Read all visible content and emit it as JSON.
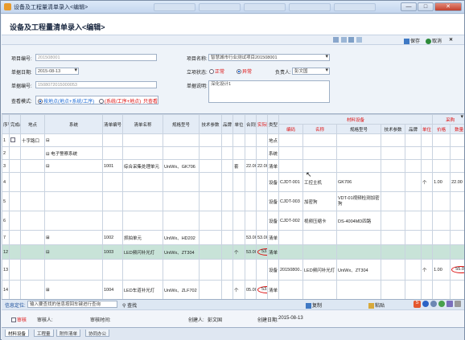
{
  "window": {
    "title": "设备及工程量清单录入<编辑>",
    "tabs": [
      "",
      "",
      "",
      "",
      ""
    ],
    "min": "—",
    "max": "□",
    "close": "✕"
  },
  "header": {
    "title": "设备及工程量清单录入<编辑>"
  },
  "toolbar": {
    "save": "保存",
    "cancel": "取消"
  },
  "form": {
    "project_no_label": "项目编号:",
    "project_no": "201508001",
    "project_name_label": "项目名称:",
    "project_name": "智慧城市行业测试项目201508001",
    "date_label": "单据日期:",
    "date": "2015-08-13",
    "status_label": "立项状态:",
    "status_normal": "正常",
    "status_abnormal": "异常",
    "owner_label": "负责人:",
    "owner": "彭文国",
    "doc_no_label": "单据编号:",
    "doc_no": "1508072015000053",
    "desc_label": "单据说明:",
    "desc": "深化设计1",
    "view_label": "查看模式:",
    "view_opt1": "按地点(地点+系统/工序)",
    "view_opt2": "(系统/工序+地点)",
    "view_opt3": "只查看"
  },
  "table": {
    "headers": {
      "seq": "序号",
      "complete": "完成/深化",
      "location": "地点",
      "system": "系统",
      "list_no": "清单编号",
      "list_name": "清单名称",
      "spec": "规格型号",
      "tech": "技术参数",
      "brand": "品牌",
      "unit": "单位",
      "contract_qty": "合同数量",
      "actual_qty": "实际数量",
      "type": "类型",
      "material_group": "材料设备",
      "m_code": "编码",
      "m_name": "名称",
      "m_spec": "规格型号",
      "m_tech": "技术参数",
      "m_brand": "品牌",
      "m_unit": "单位",
      "purchase_group": "采购",
      "p_price": "价格",
      "p_qty": "数量",
      "remark": "备注"
    },
    "rows": [
      {
        "seq": "1",
        "complete": "",
        "location": "十字路口",
        "system": "",
        "list_no": "",
        "list_name": "",
        "spec": "",
        "tech": "",
        "brand": "",
        "unit": "",
        "cqty": "",
        "aqty": "",
        "type": "地点",
        "code": "",
        "name": "",
        "mspec": "",
        "mtech": "",
        "mbrand": "",
        "munit": "",
        "price": "",
        "qty": "",
        "remark": ""
      },
      {
        "seq": "2",
        "complete": "",
        "location": "",
        "system": "电子警察系统",
        "list_no": "",
        "list_name": "",
        "spec": "",
        "tech": "",
        "brand": "",
        "unit": "",
        "cqty": "",
        "aqty": "",
        "type": "系统",
        "code": "",
        "name": "",
        "mspec": "",
        "mtech": "",
        "mbrand": "",
        "munit": "",
        "price": "",
        "qty": "",
        "remark": ""
      },
      {
        "seq": "3",
        "complete": "",
        "location": "",
        "system": "",
        "list_no": "1001",
        "list_name": "综合采集处理单元",
        "spec": "UniWx、GK706",
        "tech": "",
        "brand": "",
        "unit": "套",
        "cqty": "22.00",
        "aqty": "22.00",
        "type": "清单",
        "code": "",
        "name": "",
        "mspec": "",
        "mtech": "",
        "mbrand": "",
        "munit": "",
        "price": "",
        "qty": "",
        "remark": ""
      },
      {
        "seq": "4",
        "complete": "",
        "location": "",
        "system": "",
        "list_no": "",
        "list_name": "",
        "spec": "",
        "tech": "",
        "brand": "",
        "unit": "",
        "cqty": "",
        "aqty": "",
        "type": "设备",
        "code": "CJDT-001",
        "name": "工控主机",
        "mspec": "GK706",
        "mtech": "",
        "mbrand": "",
        "munit": "个",
        "price": "1.00",
        "qty": "22.00",
        "remark": ""
      },
      {
        "seq": "5",
        "complete": "",
        "location": "",
        "system": "",
        "list_no": "",
        "list_name": "",
        "spec": "",
        "tech": "",
        "brand": "",
        "unit": "",
        "cqty": "",
        "aqty": "",
        "type": "设备",
        "code": "CJDT-003",
        "name": "加密狗",
        "mspec": "VDT-01视频检测加密狗",
        "mtech": "",
        "mbrand": "",
        "munit": "",
        "price": "",
        "qty": "",
        "remark": ""
      },
      {
        "seq": "6",
        "complete": "",
        "location": "",
        "system": "",
        "list_no": "",
        "list_name": "",
        "spec": "",
        "tech": "",
        "brand": "",
        "unit": "",
        "cqty": "",
        "aqty": "",
        "type": "设备",
        "code": "CJDT-002",
        "name": "视频压缩卡",
        "mspec": "DS-4004MD四路",
        "mtech": "",
        "mbrand": "",
        "munit": "",
        "price": "",
        "qty": "",
        "remark": ""
      },
      {
        "seq": "7",
        "complete": "",
        "location": "",
        "system": "",
        "list_no": "1002",
        "list_name": "抓拍单元",
        "spec": "UniWx、HD202",
        "tech": "",
        "brand": "",
        "unit": "",
        "cqty": "53.00",
        "aqty": "53.00",
        "type": "清单",
        "code": "",
        "name": "",
        "mspec": "",
        "mtech": "",
        "mbrand": "",
        "munit": "",
        "price": "",
        "qty": "",
        "remark": ""
      },
      {
        "seq": "12",
        "complete": "",
        "location": "",
        "system": "",
        "list_no": "1003",
        "list_name": "LED频闪补光灯",
        "spec": "UniWx、ZT304",
        "tech": "",
        "brand": "",
        "unit": "个",
        "cqty": "53.00",
        "aqty": "53.00",
        "type": "清单",
        "code": "",
        "name": "",
        "mspec": "",
        "mtech": "",
        "mbrand": "",
        "munit": "",
        "price": "",
        "qty": "",
        "remark": ""
      },
      {
        "seq": "13",
        "complete": "",
        "location": "",
        "system": "",
        "list_no": "",
        "list_name": "",
        "spec": "",
        "tech": "",
        "brand": "",
        "unit": "",
        "cqty": "",
        "aqty": "",
        "type": "设备",
        "code": "20150800...",
        "name": "LED频闪补光灯",
        "mspec": "UniWx、ZT304",
        "mtech": "",
        "mbrand": "",
        "munit": "个",
        "price": "1.00",
        "qty": "55.00",
        "remark": ""
      },
      {
        "seq": "14",
        "complete": "",
        "location": "",
        "system": "",
        "list_no": "1004",
        "list_name": "LED车道补光灯",
        "spec": "UniWx、ZLF702",
        "tech": "",
        "brand": "",
        "unit": "个",
        "cqty": "05.00",
        "aqty": "53.00",
        "type": "清单",
        "code": "",
        "name": "",
        "mspec": "",
        "mtech": "",
        "mbrand": "",
        "munit": "",
        "price": "",
        "qty": "",
        "remark": ""
      }
    ]
  },
  "status_bar": {
    "locate_label": "信息定位:",
    "locate_placeholder": "输入要查找的信息按回车键进行查询",
    "find": "查找",
    "copy": "复制",
    "paste": "粘贴"
  },
  "footer": {
    "audit": "审核",
    "auditor": "审核人:",
    "audit_time": "审核时间:",
    "creator_label": "创建人:",
    "creator": "彭文国",
    "created_label": "创建日期:",
    "created": "2015-08-13"
  },
  "bottom_tabs": [
    "材料设备",
    "工程量",
    "附件清单",
    "协同办公"
  ],
  "colors": {
    "accent": "#1c6bd6",
    "alert": "#d11111",
    "selected_row": "#c8e3d8"
  }
}
